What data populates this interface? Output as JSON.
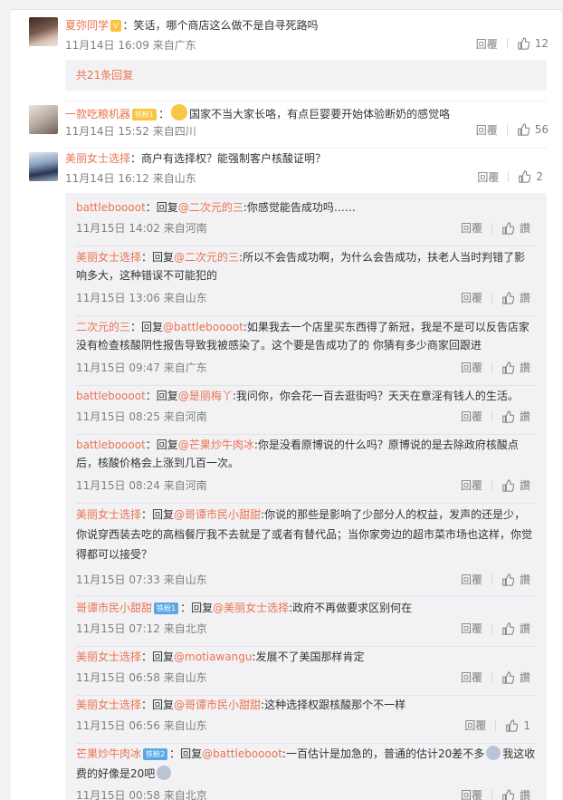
{
  "comments": [
    {
      "user": "夏弥同学",
      "text": "：笑话，哪个商店这么做不是自寻死路吗",
      "time": "11月14日 16:09",
      "loc": "来自广东",
      "reply": "回覆",
      "likes": "12"
    },
    {
      "more": "共21条回复"
    },
    {
      "user": "一款吃粮机器",
      "badge": "铁粉1",
      "text": "：",
      "text2": "国家不当大家长咯，有点巨婴要开始体验断奶的感觉咯",
      "time": "11月14日 15:52",
      "loc": "来自四川",
      "reply": "回覆",
      "likes": "56"
    },
    {
      "user": "美丽女士选择",
      "text": "：商户有选择权？能强制客户核酸证明？",
      "time": "11月14日 16:12",
      "loc": "来自山东",
      "reply": "回覆",
      "likes": "2"
    }
  ],
  "replies": [
    {
      "user": "battleboooot",
      "pre": "：回复",
      "at": "@二次元的三",
      "text": ":你感觉能告成功吗……",
      "time": "11月15日 14:02",
      "loc": "来自河南",
      "reply": "回覆",
      "like": "讚"
    },
    {
      "user": "美丽女士选择",
      "pre": "：回复",
      "at": "@二次元的三",
      "text": ":所以不会告成功啊，为什么会告成功，扶老人当时判错了影响多大，这种错误不可能犯的",
      "time": "11月15日 13:06",
      "loc": "来自山东",
      "reply": "回覆",
      "like": "讚"
    },
    {
      "user": "二次元的三",
      "pre": "：回复",
      "at": "@battleboooot",
      "text": ":如果我去一个店里买东西得了新冠，我是不是可以反告店家没有检查核酸阴性报告导致我被感染了。这个要是告成功了的 你猜有多少商家回跟进",
      "time": "11月15日 09:47",
      "loc": "来自广东",
      "reply": "回覆",
      "like": "讚"
    },
    {
      "user": "battleboooot",
      "pre": "：回复",
      "at": "@是丽梅丫",
      "text": ":我问你，你会花一百去逛街吗？天天在意淫有钱人的生活。",
      "time": "11月15日 08:25",
      "loc": "来自河南",
      "reply": "回覆",
      "like": "讚"
    },
    {
      "user": "battleboooot",
      "pre": "：回复",
      "at": "@芒果炒牛肉冰",
      "text": ":你是没看原博说的什么吗？原博说的是去除政府核酸点后，核酸价格会上涨到几百一次。",
      "time": "11月15日 08:24",
      "loc": "来自河南",
      "reply": "回覆",
      "like": "讚"
    },
    {
      "user": "美丽女士选择",
      "pre": "：回复",
      "at": "@哥谭市民小甜甜",
      "text": ":你说的那些是影响了少部分人的权益，发声的还是少，你说穿西装去吃的高档餐厅我不去就是了或者有替代品；当你家旁边的超市菜市场也这样，你觉得都可以接受？",
      "time": "11月15日 07:33",
      "loc": "来自山东",
      "reply": "回覆",
      "like": "讚"
    },
    {
      "user": "哥谭市民小甜甜",
      "badge": "铁粉1",
      "pre": "：回复",
      "at": "@美丽女士选择",
      "text": ":政府不再做要求区别何在",
      "time": "11月15日 07:12",
      "loc": "来自北京",
      "reply": "回覆",
      "like": "讚"
    },
    {
      "user": "美丽女士选择",
      "pre": "：回复",
      "at": "@motiawangu",
      "text": ":发展不了美国那样肯定",
      "time": "11月15日 06:58",
      "loc": "来自山东",
      "reply": "回覆",
      "like": "讚"
    },
    {
      "user": "美丽女士选择",
      "pre": "：回复",
      "at": "@哥谭市民小甜甜",
      "text": ":这种选择权跟核酸那个不一样",
      "time": "11月15日 06:56",
      "loc": "来自山东",
      "reply": "回覆",
      "like": "1"
    },
    {
      "user": "芒果炒牛肉冰",
      "badge": "铁粉2",
      "pre": "：回复",
      "at": "@battleboooot",
      "text": ":一百估计是加急的，普通的估计20差不多",
      "text2": "我这收费的好像是20吧",
      "time": "11月15日 00:58",
      "loc": "来自北京",
      "reply": "回覆",
      "like": "讚"
    }
  ],
  "colors": {
    "accent": "#eb7350",
    "meta": "#808080",
    "subbg": "#f2f2f5"
  }
}
